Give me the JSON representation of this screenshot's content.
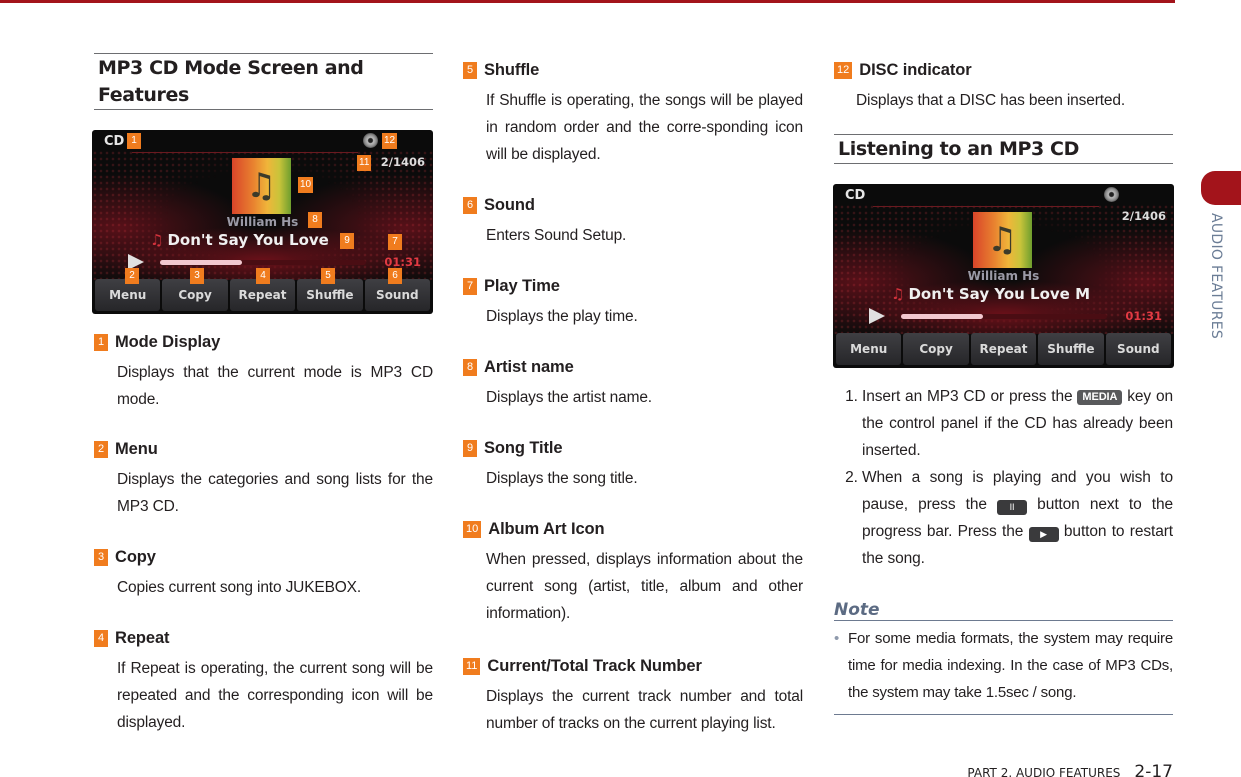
{
  "page": {
    "accent_color": "#a3141b",
    "badge_color": "#f07c1e",
    "side_tab_label": "AUDIO FEATURES",
    "footer": {
      "part_label": "PART 2. AUDIO FEATURES",
      "page_number": "2-17"
    }
  },
  "section1": {
    "title": "MP3 CD Mode Screen and Features",
    "screen": {
      "mode": "CD",
      "track": "2/1406",
      "artist": "William Hs",
      "song": "Don't Say You Love",
      "play_time": "01:31",
      "progress_fraction": 0.4,
      "buttons": [
        "Menu",
        "Copy",
        "Repeat",
        "Shuffle",
        "Sound"
      ],
      "callouts": [
        "1",
        "2",
        "3",
        "4",
        "5",
        "6",
        "7",
        "8",
        "9",
        "10",
        "11",
        "12"
      ]
    },
    "items": [
      {
        "num": "1",
        "title": "Mode Display",
        "desc": "Displays that the current mode is MP3 CD mode."
      },
      {
        "num": "2",
        "title": "Menu",
        "desc": "Displays the categories and song lists for the MP3 CD."
      },
      {
        "num": "3",
        "title": "Copy",
        "desc": "Copies current song into JUKEBOX."
      },
      {
        "num": "4",
        "title": "Repeat",
        "desc": "If Repeat is operating, the current song will be repeated and the corresponding icon will be displayed."
      },
      {
        "num": "5",
        "title": "Shuffle",
        "desc": "If Shuffle is operating, the songs will be played in random order and the corre-sponding icon will be displayed."
      },
      {
        "num": "6",
        "title": "Sound",
        "desc": "Enters Sound Setup."
      },
      {
        "num": "7",
        "title": "Play Time",
        "desc": "Displays the play time."
      },
      {
        "num": "8",
        "title": "Artist name",
        "desc": "Displays the artist name."
      },
      {
        "num": "9",
        "title": "Song Title",
        "desc": "Displays the song title."
      },
      {
        "num": "10",
        "title": "Album Art Icon",
        "desc": "When pressed, displays information about the current song (artist, title, album and other information)."
      },
      {
        "num": "11",
        "title": "Current/Total Track Number",
        "desc": "Displays the current track number and total number of tracks on the current playing list."
      },
      {
        "num": "12",
        "title": "DISC indicator",
        "desc": "Displays that a DISC has been inserted."
      }
    ]
  },
  "section2": {
    "title": "Listening to an MP3 CD",
    "screen": {
      "mode": "CD",
      "track": "2/1406",
      "artist": "William Hs",
      "song": "Don't Say You Love M",
      "play_time": "01:31",
      "progress_fraction": 0.4,
      "buttons": [
        "Menu",
        "Copy",
        "Repeat",
        "Shuffle",
        "Sound"
      ]
    },
    "steps": [
      {
        "num": "1.",
        "before": "Insert an MP3 CD or press the ",
        "key": "MEDIA",
        "after": " key on the control panel if the CD has already been inserted."
      },
      {
        "num": "2.",
        "before": "When a song is playing and you wish to pause, press the ",
        "pause_icon": "II",
        "middle": " button next to the progress bar. Press the ",
        "play_icon": "▶",
        "after": " button to restart the song."
      }
    ],
    "note": {
      "title": "Note",
      "bullets": [
        "For some media formats, the system may require time for media indexing. In the case of MP3 CDs, the system may take 1.5sec / song."
      ]
    }
  }
}
